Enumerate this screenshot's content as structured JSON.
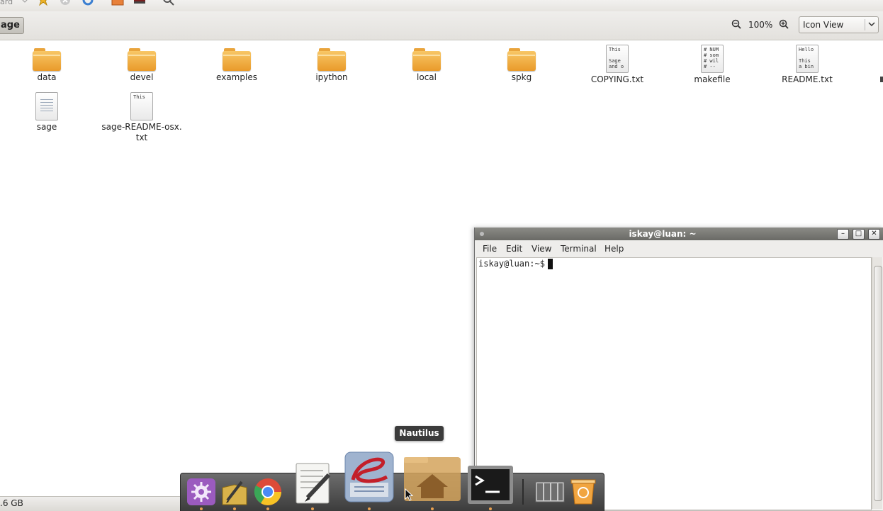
{
  "toolbar": {
    "partial_text": "ard"
  },
  "location": {
    "current": "age"
  },
  "zoom": {
    "level": "100%",
    "view_mode": "Icon View"
  },
  "files": [
    {
      "name": "data",
      "kind": "folder"
    },
    {
      "name": "devel",
      "kind": "folder"
    },
    {
      "name": "examples",
      "kind": "folder"
    },
    {
      "name": "ipython",
      "kind": "folder"
    },
    {
      "name": "local",
      "kind": "folder"
    },
    {
      "name": "spkg",
      "kind": "folder"
    },
    {
      "name": "COPYING.txt",
      "kind": "text",
      "preview": "This\n\nSage\nand o"
    },
    {
      "name": "makefile",
      "kind": "text",
      "preview": "# NUM\n# som\n# wil\n# --"
    },
    {
      "name": "README.txt",
      "kind": "text",
      "preview": "Hello\n\nThis\na bin"
    },
    {
      "name": "sage",
      "kind": "script"
    },
    {
      "name": "sage-README-osx.",
      "name_line2": "txt",
      "kind": "text",
      "preview": "This"
    }
  ],
  "status": {
    "free_space": ".6 GB"
  },
  "terminal": {
    "title": "iskay@luan: ~",
    "menu": [
      "File",
      "Edit",
      "View",
      "Terminal",
      "Help"
    ],
    "prompt": "iskay@luan:~$ "
  },
  "dock": {
    "tooltip": "Nautilus",
    "items": [
      "settings-app",
      "notes-app",
      "chrome-browser",
      "text-editor",
      "emacs-editor",
      "nautilus-home",
      "terminal",
      "workspace-switcher",
      "trash"
    ]
  },
  "colors": {
    "folder": "#f2b143",
    "dock_bg": "#4a4a4a",
    "titlebar": "#7a7a76"
  }
}
